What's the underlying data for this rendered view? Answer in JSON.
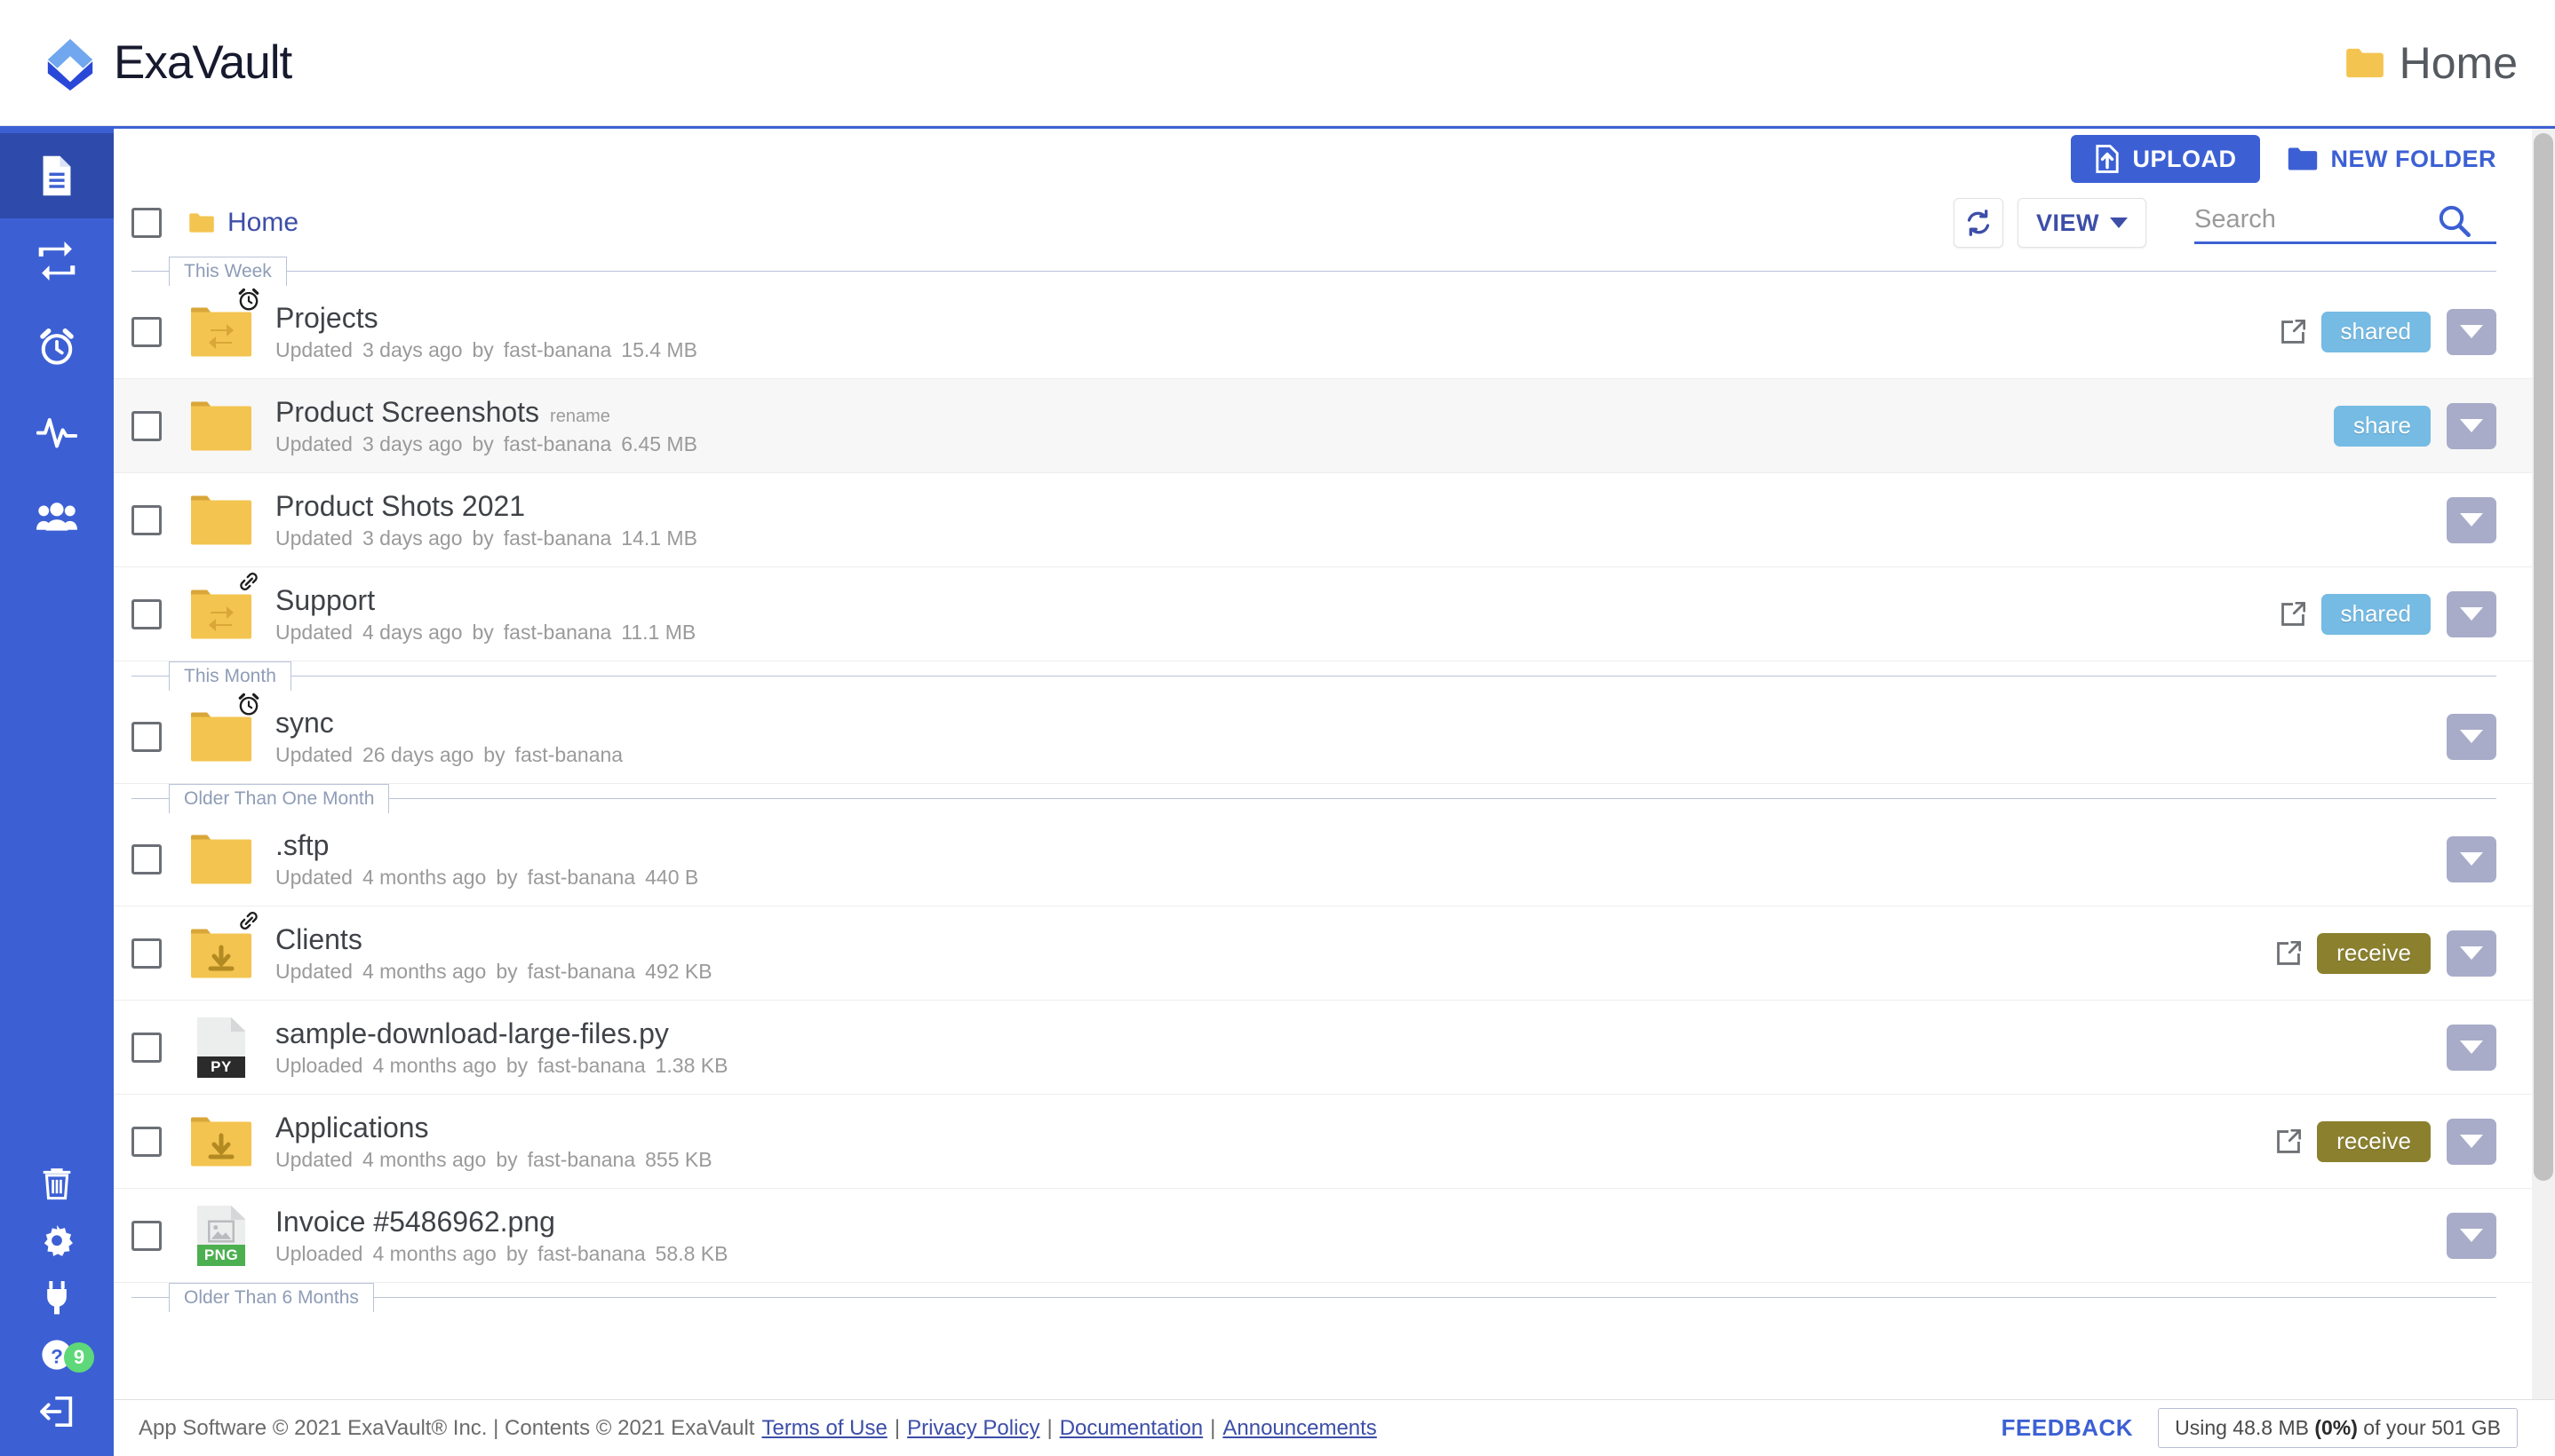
{
  "header": {
    "brand_name": "ExaVault",
    "brand_logo_icon": "exavault-chevron-logo",
    "page_title": "Home",
    "page_title_icon": "folder-icon"
  },
  "sidebar": {
    "top_items": [
      {
        "icon": "files-document-icon",
        "name": "files",
        "active": true
      },
      {
        "icon": "transfer-exchange-icon",
        "name": "transfers",
        "active": false
      },
      {
        "icon": "alarm-clock-icon",
        "name": "notifications",
        "active": false
      },
      {
        "icon": "activity-pulse-icon",
        "name": "activity",
        "active": false
      },
      {
        "icon": "users-group-icon",
        "name": "users",
        "active": false
      }
    ],
    "bottom_items": [
      {
        "icon": "trash-icon",
        "name": "trash",
        "badge": null
      },
      {
        "icon": "gear-icon",
        "name": "settings",
        "badge": null
      },
      {
        "icon": "plug-icon",
        "name": "integrations",
        "badge": null
      },
      {
        "icon": "help-question-icon",
        "name": "help",
        "badge": "9"
      },
      {
        "icon": "logout-icon",
        "name": "logout",
        "badge": null
      }
    ]
  },
  "actions": {
    "upload_label": "UPLOAD",
    "upload_icon": "upload-file-icon",
    "new_folder_label": "NEW FOLDER",
    "new_folder_icon": "folder-icon"
  },
  "toolbar": {
    "breadcrumb": "Home",
    "breadcrumb_icon": "folder-icon",
    "refresh_icon": "refresh-icon",
    "view_label": "VIEW",
    "search_placeholder": "Search",
    "search_value": "",
    "search_icon": "search-icon"
  },
  "groups": [
    {
      "label": "This Week",
      "rows": [
        {
          "name": "Projects",
          "icon": "folder-send-receive-icon",
          "badge_icon": "alarm-clock-icon",
          "meta": [
            "Updated",
            "3 days ago",
            "by",
            "fast-banana",
            "15.4 MB"
          ],
          "ext_link": true,
          "pill": "shared",
          "pill_kind": "shared",
          "rename_hint": null,
          "hover": false
        },
        {
          "name": "Product Screenshots",
          "icon": "folder-icon",
          "badge_icon": null,
          "meta": [
            "Updated",
            "3 days ago",
            "by",
            "fast-banana",
            "6.45 MB"
          ],
          "ext_link": false,
          "pill": "share",
          "pill_kind": "share",
          "rename_hint": "rename",
          "hover": true
        },
        {
          "name": "Product Shots 2021",
          "icon": "folder-icon",
          "badge_icon": null,
          "meta": [
            "Updated",
            "3 days ago",
            "by",
            "fast-banana",
            "14.1 MB"
          ],
          "ext_link": false,
          "pill": null,
          "pill_kind": null,
          "rename_hint": null,
          "hover": false
        },
        {
          "name": "Support",
          "icon": "folder-send-receive-icon",
          "badge_icon": "link-chain-icon",
          "meta": [
            "Updated",
            "4 days ago",
            "by",
            "fast-banana",
            "11.1 MB"
          ],
          "ext_link": true,
          "pill": "shared",
          "pill_kind": "shared",
          "rename_hint": null,
          "hover": false
        }
      ]
    },
    {
      "label": "This Month",
      "rows": [
        {
          "name": "sync",
          "icon": "folder-icon",
          "badge_icon": "alarm-clock-icon",
          "meta": [
            "Updated",
            "26 days ago",
            "by",
            "fast-banana"
          ],
          "ext_link": false,
          "pill": null,
          "pill_kind": null,
          "rename_hint": null,
          "hover": false
        }
      ]
    },
    {
      "label": "Older Than One Month",
      "rows": [
        {
          "name": ".sftp",
          "icon": "folder-icon",
          "badge_icon": null,
          "meta": [
            "Updated",
            "4 months ago",
            "by",
            "fast-banana",
            "440 B"
          ],
          "ext_link": false,
          "pill": null,
          "pill_kind": null,
          "rename_hint": null,
          "hover": false
        },
        {
          "name": "Clients",
          "icon": "folder-download-icon",
          "badge_icon": "link-chain-icon",
          "meta": [
            "Updated",
            "4 months ago",
            "by",
            "fast-banana",
            "492 KB"
          ],
          "ext_link": true,
          "pill": "receive",
          "pill_kind": "receive",
          "rename_hint": null,
          "hover": false
        },
        {
          "name": "sample-download-large-files.py",
          "icon": "file-py-icon",
          "file_ext_label": "PY",
          "badge_icon": null,
          "meta": [
            "Uploaded",
            "4 months ago",
            "by",
            "fast-banana",
            "1.38 KB"
          ],
          "ext_link": false,
          "pill": null,
          "pill_kind": null,
          "rename_hint": null,
          "hover": false
        },
        {
          "name": "Applications",
          "icon": "folder-download-icon",
          "badge_icon": null,
          "meta": [
            "Updated",
            "4 months ago",
            "by",
            "fast-banana",
            "855 KB"
          ],
          "ext_link": true,
          "pill": "receive",
          "pill_kind": "receive",
          "rename_hint": null,
          "hover": false
        },
        {
          "name": "Invoice #5486962.png",
          "icon": "file-png-icon",
          "file_ext_label": "PNG",
          "badge_icon": null,
          "meta": [
            "Uploaded",
            "4 months ago",
            "by",
            "fast-banana",
            "58.8 KB"
          ],
          "ext_link": false,
          "pill": null,
          "pill_kind": null,
          "rename_hint": null,
          "hover": false
        }
      ]
    },
    {
      "label": "Older Than 6 Months",
      "rows": []
    }
  ],
  "footer": {
    "copyright": "App Software © 2021 ExaVault® Inc. | Contents © 2021 ExaVault",
    "links": [
      "Terms of Use",
      "Privacy Policy",
      "Documentation",
      "Announcements"
    ],
    "separator": "|",
    "feedback_label": "FEEDBACK",
    "quota_prefix": "Using 48.8 MB ",
    "quota_percent": "(0%)",
    "quota_suffix": " of your 501 GB"
  },
  "colors": {
    "brand_blue": "#3c60d4",
    "sidebar_active": "#2e4bab",
    "folder_yellow": "#f3c44f",
    "shared_pill": "#75bbe4",
    "receive_pill": "#8b802e",
    "dropdown_gray": "#a8acc9",
    "badge_green": "#5ed878"
  }
}
